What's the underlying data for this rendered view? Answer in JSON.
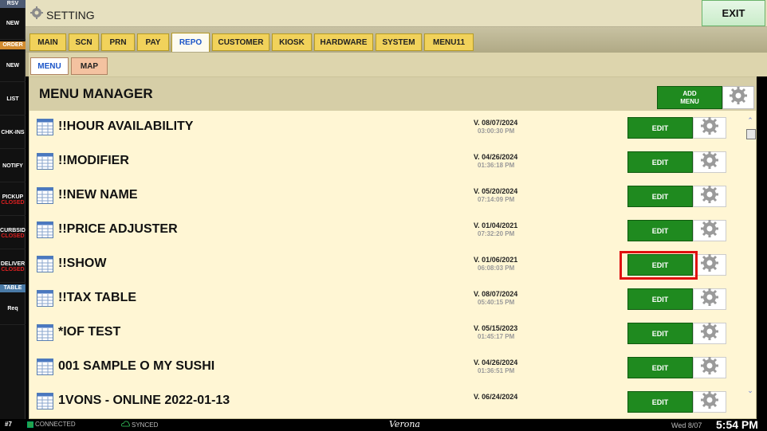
{
  "sidebar": {
    "rsv": "RSV",
    "rsv_new": "NEW",
    "order": "ORDER",
    "order_new": "NEW",
    "list": "LIST",
    "chk_ins": "CHK-INS",
    "notify": "NOTIFY",
    "pickup": {
      "label": "PICKUP",
      "status": "CLOSED"
    },
    "curbside": {
      "label": "CURBSID",
      "status": "CLOSED"
    },
    "delivery": {
      "label": "DELIVER",
      "status": "CLOSED"
    },
    "table": "TABLE",
    "req": "Req"
  },
  "header": {
    "title": "SETTING",
    "exit_label": "EXIT"
  },
  "tabs": [
    {
      "label": "MAIN"
    },
    {
      "label": "SCN"
    },
    {
      "label": "PRN"
    },
    {
      "label": "PAY"
    },
    {
      "label": "REPO"
    },
    {
      "label": "CUSTOMER"
    },
    {
      "label": "KIOSK"
    },
    {
      "label": "HARDWARE"
    },
    {
      "label": "SYSTEM"
    },
    {
      "label": "MENU11"
    }
  ],
  "active_tab": "REPO",
  "subtabs": [
    {
      "label": "MENU"
    },
    {
      "label": "MAP"
    }
  ],
  "manager": {
    "title": "MENU MANAGER",
    "add_label_1": "ADD",
    "add_label_2": "MENU"
  },
  "menus": [
    {
      "name": "!!HOUR AVAILABILITY",
      "version": "V. 08/07/2024",
      "time": "03:00:30 PM",
      "edit": "EDIT"
    },
    {
      "name": "!!MODIFIER",
      "version": "V. 04/26/2024",
      "time": "01:36:18 PM",
      "edit": "EDIT"
    },
    {
      "name": "!!NEW NAME",
      "version": "V. 05/20/2024",
      "time": "07:14:09 PM",
      "edit": "EDIT"
    },
    {
      "name": "!!PRICE ADJUSTER",
      "version": "V. 01/04/2021",
      "time": "07:32:20 PM",
      "edit": "EDIT"
    },
    {
      "name": "!!SHOW",
      "version": "V. 01/06/2021",
      "time": "06:08:03 PM",
      "edit": "EDIT"
    },
    {
      "name": "!!TAX TABLE",
      "version": "V. 08/07/2024",
      "time": "05:40:15 PM",
      "edit": "EDIT"
    },
    {
      "name": "*IOF TEST",
      "version": "V. 05/15/2023",
      "time": "01:45:17 PM",
      "edit": "EDIT"
    },
    {
      "name": "001 SAMPLE O MY SUSHI",
      "version": "V. 04/26/2024",
      "time": "01:36:51 PM",
      "edit": "EDIT"
    },
    {
      "name": "1VONS - ONLINE 2022-01-13",
      "version": "V. 06/24/2024",
      "time": "",
      "edit": "EDIT"
    }
  ],
  "status": {
    "station": "#7",
    "connected": "CONNECTED",
    "synced": "SYNCED",
    "store": "Verona",
    "date": "Wed 8/07",
    "time": "5:54 PM"
  },
  "colors": {
    "accent_green": "#1f8a1f",
    "tab_yellow": "#f1d25b",
    "highlight_red": "#e01010",
    "closed_red": "#e02020"
  }
}
